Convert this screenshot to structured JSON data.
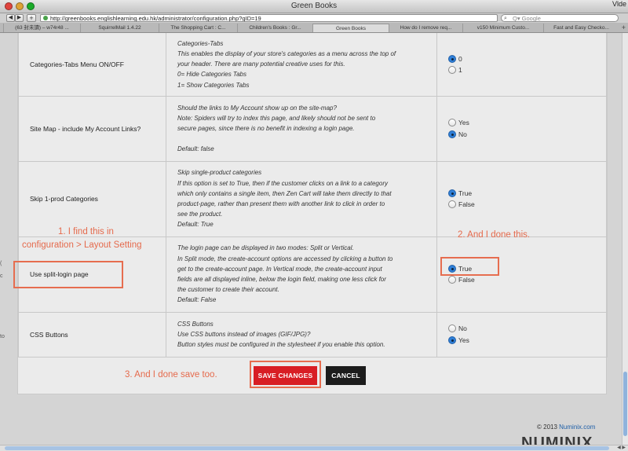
{
  "window": {
    "title": "Green Books",
    "corner_text": "Vlde"
  },
  "toolbar": {
    "back": "◀",
    "forward": "▶",
    "add": "+",
    "url": "http://greenbooks.englishlearning.edu.hk/administrator/configuration.php?gID=19",
    "reload": "C",
    "search_placeholder": "Q▾ Google"
  },
  "tabs": [
    {
      "label": "(63 封未讀) – w74r48 ..."
    },
    {
      "label": "SquirrelMail 1.4.22"
    },
    {
      "label": "The Shopping Cart : C..."
    },
    {
      "label": "Children's Books : Gr..."
    },
    {
      "label": "Green Books"
    },
    {
      "label": "How do I remove req..."
    },
    {
      "label": "v150 Minimum Custo..."
    },
    {
      "label": "Fast and Easy Checko..."
    }
  ],
  "edge": {
    "a": "(",
    "b": "c",
    "c": "to"
  },
  "config_rows": [
    {
      "name": "Categories-Tabs Menu ON/OFF",
      "description": [
        "Categories-Tabs",
        "This enables the display of your store's categories as a menu across the top of",
        "your header. There are many potential creative uses for this.",
        "0= Hide Categories Tabs",
        "1= Show Categories Tabs"
      ],
      "options": [
        {
          "label": "0",
          "selected": true
        },
        {
          "label": "1",
          "selected": false
        }
      ]
    },
    {
      "name": "Site Map - include My Account Links?",
      "description": [
        "Should the links to My Account show up on the site-map?",
        "Note: Spiders will try to index this page, and likely should not be sent to",
        "secure pages, since there is no benefit in indexing a login page.",
        "",
        "Default: false"
      ],
      "options": [
        {
          "label": "Yes",
          "selected": false
        },
        {
          "label": "No",
          "selected": true
        }
      ]
    },
    {
      "name": "Skip 1-prod Categories",
      "description": [
        "Skip single-product categories",
        "If this option is set to True, then if the customer clicks on a link to a category",
        "which only contains a single item, then Zen Cart will take them directly to that",
        "product-page, rather than present them with another link to click in order to",
        "see the product.",
        "Default: True"
      ],
      "options": [
        {
          "label": "True",
          "selected": true
        },
        {
          "label": "False",
          "selected": false
        }
      ]
    },
    {
      "name": "Use split-login page",
      "description": [
        "The login page can be displayed in two modes: Split or Vertical.",
        "In Split mode, the create-account options are accessed by clicking a button to",
        "get to the create-account page. In Vertical mode, the create-account input",
        "fields are all displayed inline, below the login field, making one less click for",
        "the customer to create their account.",
        "Default: False"
      ],
      "options": [
        {
          "label": "True",
          "selected": true
        },
        {
          "label": "False",
          "selected": false
        }
      ]
    },
    {
      "name": "CSS Buttons",
      "description": [
        "CSS Buttons",
        "Use CSS buttons instead of images (GIF/JPG)?",
        "Button styles must be configured in the stylesheet if you enable this option."
      ],
      "options": [
        {
          "label": "No",
          "selected": false
        },
        {
          "label": "Yes",
          "selected": true
        }
      ]
    }
  ],
  "buttons": {
    "save": "SAVE CHANGES",
    "cancel": "CANCEL"
  },
  "annotations": {
    "note1_line1": "1. I find this in",
    "note1_line2": "configuration > Layout Setting",
    "note2": "2. And I done this.",
    "note3": "3. And I done save too."
  },
  "footer": {
    "copyright": "© 2013",
    "brand_link": "Numinix.com",
    "logo_fragment": "NUMINIX"
  },
  "colors": {
    "annotation": "#e56a4c",
    "save_button": "#d81e24",
    "cancel_button": "#1c1c1c",
    "radio_selected": "#2f7fd8",
    "link": "#1f5fa8"
  }
}
